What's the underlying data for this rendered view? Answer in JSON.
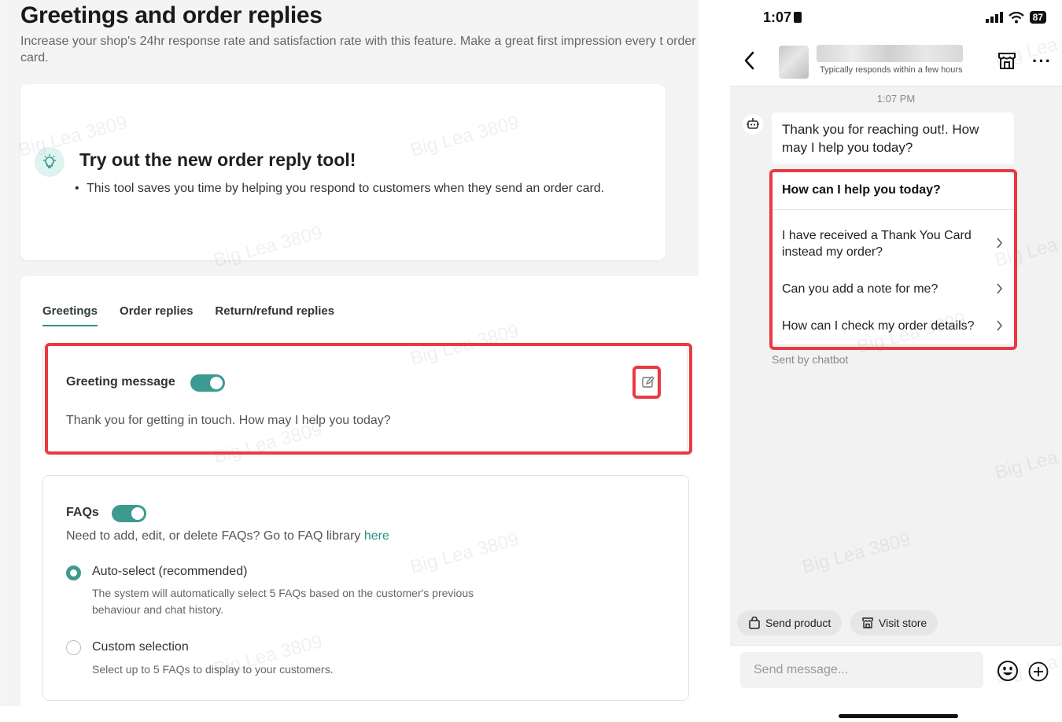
{
  "page": {
    "title": "Greetings and order replies",
    "description": "Increase your shop's 24hr response rate and satisfaction rate with this feature. Make a great first impression every t order card."
  },
  "promo": {
    "title": "Try out the new order reply tool!",
    "bullet": "This tool saves you time by helping you respond to customers when they send an order card."
  },
  "tabs": [
    {
      "label": "Greetings",
      "active": true
    },
    {
      "label": "Order replies",
      "active": false
    },
    {
      "label": "Return/refund replies",
      "active": false
    }
  ],
  "greeting": {
    "label": "Greeting message",
    "enabled": true,
    "message": "Thank you for getting in touch. How may I help you today?"
  },
  "faqs": {
    "label": "FAQs",
    "enabled": true,
    "help_text": "Need to add, edit, or delete FAQs? Go to FAQ library ",
    "link_text": "here",
    "options": [
      {
        "title": "Auto-select (recommended)",
        "desc": "The system will automatically select 5 FAQs based on the customer's previous behaviour and chat history.",
        "selected": true
      },
      {
        "title": "Custom selection",
        "desc": "Select up to 5 FAQs to display to your customers.",
        "selected": false
      }
    ]
  },
  "watermark": "Big Lea 3809",
  "phone": {
    "status": {
      "time": "1:07",
      "battery": "87"
    },
    "header": {
      "responds": "Typically responds within a few hours"
    },
    "chat": {
      "timestamp": "1:07 PM",
      "bot_message": "Thank you for reaching out!. How may I help you today?",
      "quick_title": "How can I help you today?",
      "quick_items": [
        "I have received a Thank You Card instead my order?",
        "Can you add a note for me?",
        "How can I check my order details?"
      ],
      "sent_by": "Sent by chatbot"
    },
    "actions": {
      "send_product": "Send product",
      "visit_store": "Visit store"
    },
    "input": {
      "placeholder": "Send message..."
    }
  },
  "colors": {
    "accent": "#3c9a91",
    "highlight": "#ea3942"
  }
}
